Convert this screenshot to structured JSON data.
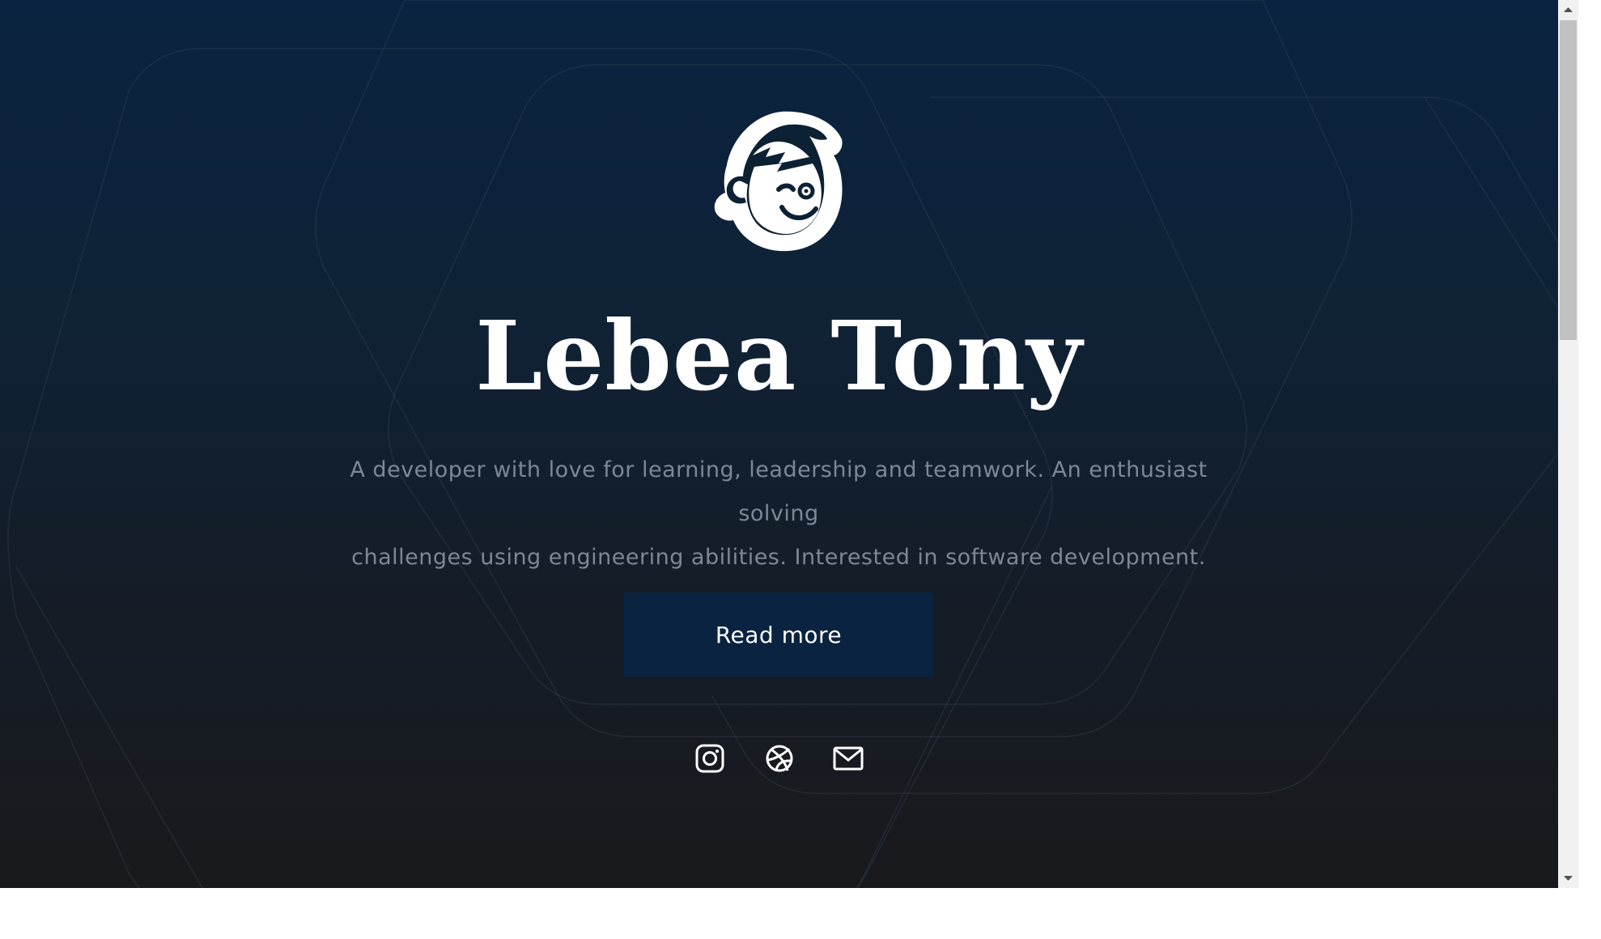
{
  "hero": {
    "name": "Lebea Tony",
    "tagline_line1": "A developer with love for learning, leadership and teamwork. An enthusiast solving",
    "tagline_line2": "challenges using engineering abilities. Interested in software development.",
    "cta_label": "Read more"
  },
  "logo": {
    "icon": "winking-boy-face-icon"
  },
  "socials": [
    {
      "icon": "instagram-icon"
    },
    {
      "icon": "dribbble-icon"
    },
    {
      "icon": "mail-icon"
    }
  ],
  "colors": {
    "background_top": "#0a2340",
    "background_bottom": "#191a1d",
    "button": "#0a2340",
    "text": "#ffffff",
    "tagline": "#7d8896"
  }
}
